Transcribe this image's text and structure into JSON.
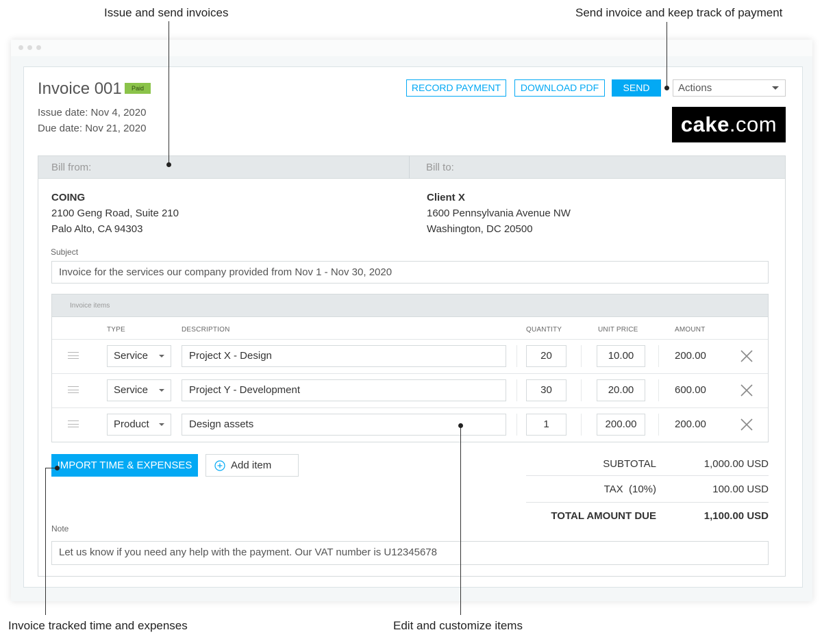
{
  "callouts": {
    "issue_send": "Issue and send invoices",
    "send_track": "Send invoice and keep track of payment",
    "tracked_time": "Invoice tracked time and expenses",
    "edit_items": "Edit and customize items"
  },
  "invoice": {
    "title": "Invoice 001",
    "status_badge": "Paid",
    "issue_date": "Issue date: Nov 4, 2020",
    "due_date": "Due date: Nov 21, 2020"
  },
  "toolbar": {
    "record_payment": "RECORD PAYMENT",
    "download_pdf": "DOWNLOAD PDF",
    "send": "SEND",
    "actions_selected": "Actions"
  },
  "logo": {
    "brand": "cake",
    "suffix": ".com"
  },
  "bill": {
    "from_label": "Bill from:",
    "to_label": "Bill to:",
    "from": {
      "name": "COING",
      "line1": "2100 Geng Road, Suite 210",
      "line2": "Palo Alto, CA 94303"
    },
    "to": {
      "name": "Client X",
      "line1": "1600 Pennsylvania Avenue NW",
      "line2": "Washington, DC 20500"
    }
  },
  "subject": {
    "label": "Subject",
    "value": "Invoice for the services our company provided from Nov 1 - Nov 30, 2020"
  },
  "items": {
    "title": "Invoice items",
    "headers": {
      "type": "TYPE",
      "description": "DESCRIPTION",
      "quantity": "QUANTITY",
      "unit_price": "UNIT PRICE",
      "amount": "AMOUNT"
    },
    "rows": [
      {
        "type": "Service",
        "description": "Project X - Design",
        "quantity": "20",
        "unit_price": "10.00",
        "amount": "200.00"
      },
      {
        "type": "Service",
        "description": "Project Y - Development",
        "quantity": "30",
        "unit_price": "20.00",
        "amount": "600.00"
      },
      {
        "type": "Product",
        "description": "Design assets",
        "quantity": "1",
        "unit_price": "200.00",
        "amount": "200.00"
      }
    ]
  },
  "buttons": {
    "import": "IMPORT TIME & EXPENSES",
    "add_item": "Add item"
  },
  "totals": {
    "subtotal_label": "SUBTOTAL",
    "subtotal_value": "1,000.00 USD",
    "tax_label": "TAX  (10%)",
    "tax_value": "100.00 USD",
    "total_label": "TOTAL AMOUNT DUE",
    "total_value": "1,100.00 USD"
  },
  "note": {
    "label": "Note",
    "value": "Let us know if you need any help with the payment. Our VAT number is U12345678"
  },
  "colors": {
    "accent": "#03a9f4",
    "paid_badge": "#8bc34a",
    "header_bg": "#e4e8ea"
  }
}
